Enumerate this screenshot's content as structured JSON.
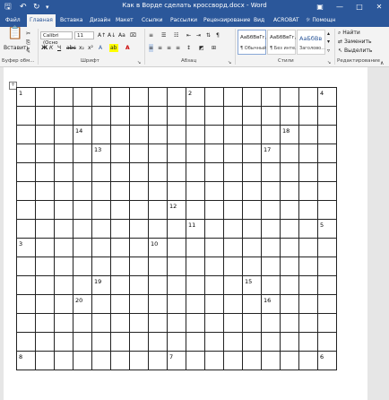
{
  "window": {
    "title": "Как в Ворде сделать кроссворд.docx - Word"
  },
  "qat": {
    "save_icon": "save-icon",
    "undo_icon": "undo-icon",
    "redo_icon": "redo-icon"
  },
  "tabs": [
    {
      "label": "Файл"
    },
    {
      "label": "Главная"
    },
    {
      "label": "Вставка"
    },
    {
      "label": "Дизайн"
    },
    {
      "label": "Макет"
    },
    {
      "label": "Ссылки"
    },
    {
      "label": "Рассылки"
    },
    {
      "label": "Рецензирование"
    },
    {
      "label": "Вид"
    },
    {
      "label": "ACROBAT"
    },
    {
      "label": "Помощн"
    }
  ],
  "ribbon": {
    "paste_label": "Вставить",
    "font_name": "Calibri (Осно",
    "font_size": "11",
    "styles": [
      {
        "preview": "АаБбВвГг,",
        "name": "¶ Обычный"
      },
      {
        "preview": "АаБбВвГг,",
        "name": "¶ Без инте..."
      },
      {
        "preview": "АаБбВв",
        "name": "Заголово..."
      }
    ],
    "find": "Найти",
    "replace": "Заменить",
    "select": "Выделить",
    "groups": {
      "clipboard": "Буфер обм...",
      "font": "Шрифт",
      "paragraph": "Абзац",
      "styles": "Стили",
      "editing": "Редактирование"
    }
  },
  "crossword": {
    "rows": 15,
    "cols": 17,
    "numbers": [
      {
        "n": "1",
        "r": 0,
        "c": 0
      },
      {
        "n": "2",
        "r": 0,
        "c": 9
      },
      {
        "n": "4",
        "r": 0,
        "c": 16
      },
      {
        "n": "14",
        "r": 2,
        "c": 3
      },
      {
        "n": "18",
        "r": 2,
        "c": 14
      },
      {
        "n": "13",
        "r": 3,
        "c": 4
      },
      {
        "n": "17",
        "r": 3,
        "c": 13
      },
      {
        "n": "12",
        "r": 6,
        "c": 8
      },
      {
        "n": "11",
        "r": 7,
        "c": 9
      },
      {
        "n": "5",
        "r": 7,
        "c": 16
      },
      {
        "n": "3",
        "r": 8,
        "c": 0
      },
      {
        "n": "10",
        "r": 8,
        "c": 7
      },
      {
        "n": "19",
        "r": 10,
        "c": 4
      },
      {
        "n": "15",
        "r": 10,
        "c": 12
      },
      {
        "n": "20",
        "r": 11,
        "c": 3
      },
      {
        "n": "16",
        "r": 11,
        "c": 13
      },
      {
        "n": "8",
        "r": 14,
        "c": 0
      },
      {
        "n": "7",
        "r": 14,
        "c": 8
      },
      {
        "n": "6",
        "r": 14,
        "c": 16
      }
    ]
  }
}
